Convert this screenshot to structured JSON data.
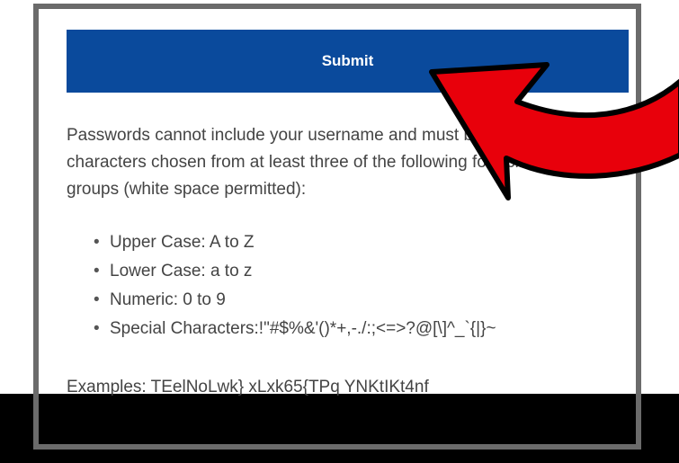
{
  "submit_label": "Submit",
  "password_policy": {
    "description": "Passwords cannot include your username and must be at least 10 characters chosen from at least three of the following four character groups (white space permitted):",
    "rules": [
      {
        "bullet": "•",
        "text": "Upper Case: A to Z"
      },
      {
        "bullet": "•",
        "text": "Lower Case: a to z"
      },
      {
        "bullet": "•",
        "text": "Numeric: 0 to 9"
      },
      {
        "bullet": "•",
        "text": "Special Characters:!\"#$%&'()*+,-./:;<=>?@[\\]^_`{|}~"
      }
    ],
    "examples": "Examples: TEelNoLwk} xLxk65{TPq YNKtIKt4nf"
  },
  "colors": {
    "submit_bg": "#0a4a9c",
    "arrow_fill": "#e8000b",
    "frame": "#6b6b6b"
  },
  "annotation": {
    "icon": "curved-red-arrow-icon"
  }
}
